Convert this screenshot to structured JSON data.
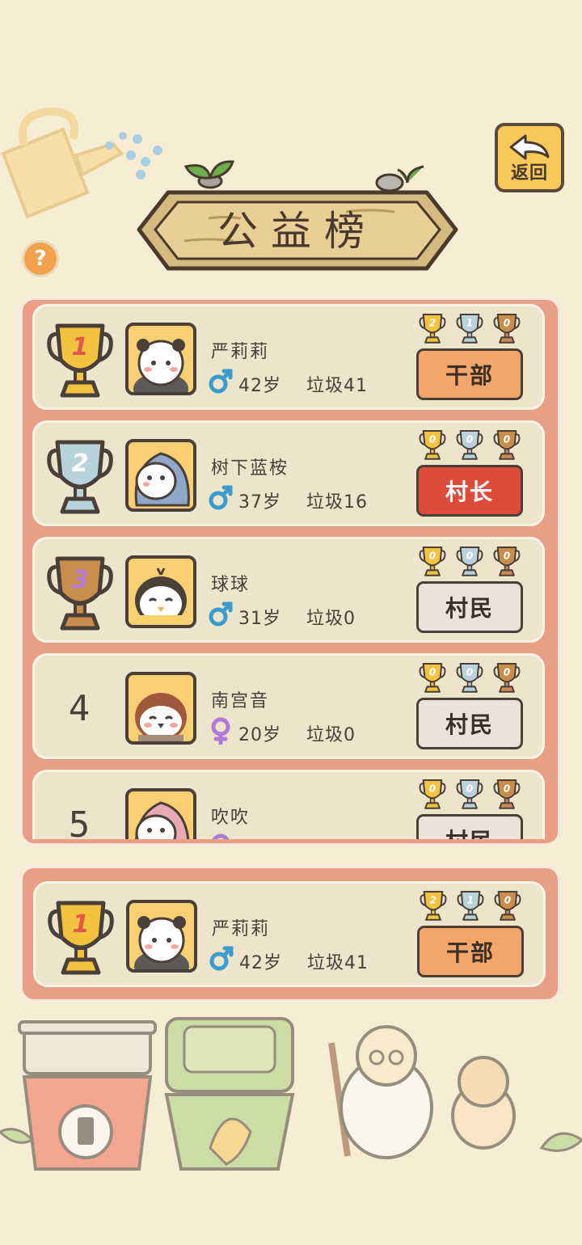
{
  "header": {
    "title": "公益榜",
    "back_label": "返回",
    "help_label": "?"
  },
  "ranking": [
    {
      "rank": "1",
      "name": "严莉莉",
      "gender": "male",
      "age": "42岁",
      "garbage": "垃圾41",
      "role": "干部",
      "role_type": "cadre",
      "medals": [
        "2",
        "1",
        "0"
      ]
    },
    {
      "rank": "2",
      "name": "树下蓝桉",
      "gender": "male",
      "age": "37岁",
      "garbage": "垃圾16",
      "role": "村长",
      "role_type": "chief",
      "medals": [
        "0",
        "0",
        "0"
      ]
    },
    {
      "rank": "3",
      "name": "球球",
      "gender": "male",
      "age": "31岁",
      "garbage": "垃圾0",
      "role": "村民",
      "role_type": "villager",
      "medals": [
        "0",
        "0",
        "0"
      ]
    },
    {
      "rank": "4",
      "name": "南宫音",
      "gender": "female",
      "age": "20岁",
      "garbage": "垃圾0",
      "role": "村民",
      "role_type": "villager",
      "medals": [
        "0",
        "0",
        "0"
      ]
    },
    {
      "rank": "5",
      "name": "吹吹",
      "gender": "female",
      "age": "",
      "garbage": "",
      "role": "村民",
      "role_type": "villager",
      "medals": [
        "0",
        "0",
        "0"
      ]
    }
  ],
  "me": {
    "rank": "1",
    "name": "严莉莉",
    "gender": "male",
    "age": "42岁",
    "garbage": "垃圾41",
    "role": "干部",
    "role_type": "cadre",
    "medals": [
      "2",
      "1",
      "0"
    ]
  },
  "colors": {
    "background": "#f7ecd4",
    "panel": "#e99f86",
    "row": "#eee4cc",
    "gold": "#f3c23e",
    "silver": "#b9d3dc",
    "bronze": "#c98d4e",
    "male": "#3a9ccf",
    "female": "#b07ad8",
    "cadre": "#f3a66a",
    "chief": "#de4c39",
    "villager": "#ece2d8"
  },
  "icons": [
    "watering-can-icon",
    "back-arrow-icon",
    "help-icon",
    "trophy-icon",
    "male-icon",
    "female-icon",
    "panda-avatar",
    "hedgehog-avatar",
    "penguin-avatar",
    "sparrow-avatar",
    "pink-hedgehog-avatar",
    "recycle-bin-icon",
    "hamster-elder-icon"
  ]
}
